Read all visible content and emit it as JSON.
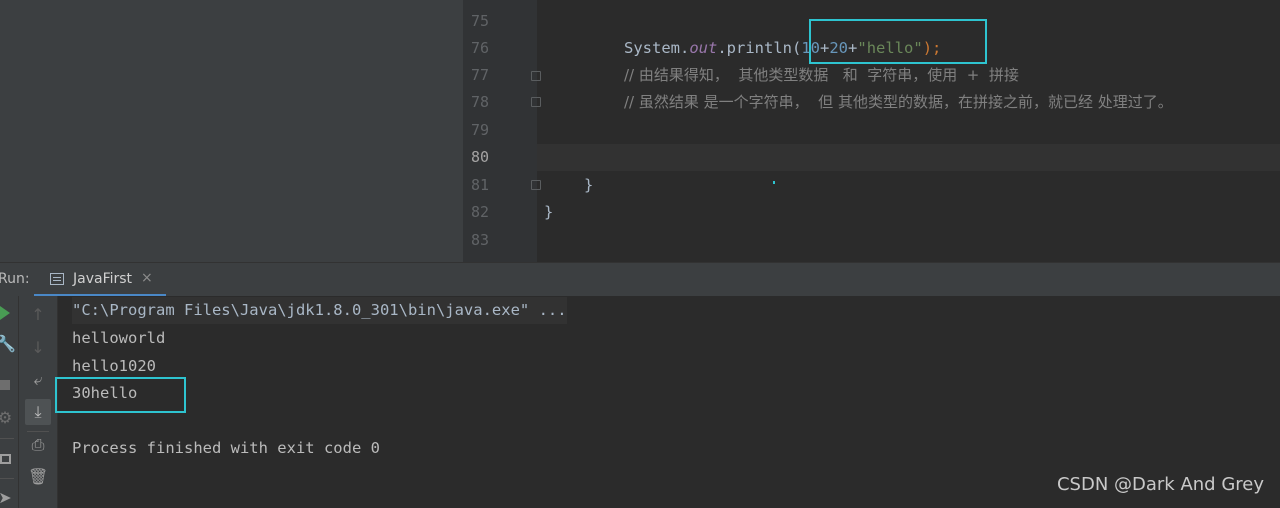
{
  "editor": {
    "lines": [
      {
        "number": "75"
      },
      {
        "number": "76",
        "code": {
          "pre": "System.",
          "field": "out",
          "mid": ".println(",
          "n1": "10",
          "plus1": "+",
          "n2": "20",
          "plus2": "+",
          "str": "\"hello\"",
          "end": ");"
        }
      },
      {
        "number": "77",
        "comment": "// 由结果得知，  其他类型数据   和  字符串，使用  +  拼接"
      },
      {
        "number": "78",
        "comment": "// 虽然结果 是一个字符串，  但 其他类型的数据，在拼接之前，就已经 处理过了。"
      },
      {
        "number": "79"
      },
      {
        "number": "80"
      },
      {
        "number": "81",
        "code_text": "}"
      },
      {
        "number": "82",
        "code_text": "}"
      },
      {
        "number": "83"
      }
    ]
  },
  "run_panel": {
    "label": "Run:",
    "tab_label": "JavaFirst",
    "tab_close": "×",
    "icons": {
      "run": "run-icon",
      "wrench": "wrench-icon",
      "stop": "stop-icon",
      "up": "arrow-up-icon",
      "down": "arrow-down-icon",
      "wrap": "soft-wrap-icon",
      "scroll_end": "scroll-to-end-icon",
      "print": "print-icon",
      "trash": "trash-icon"
    }
  },
  "console": {
    "command": "\"C:\\Program Files\\Java\\jdk1.8.0_301\\bin\\java.exe\" ...",
    "outputs": [
      "helloworld",
      "hello1020",
      "30hello"
    ],
    "exit": "Process finished with exit code 0"
  },
  "watermark": "CSDN @Dark And Grey",
  "colors": {
    "highlight": "#2ec4d0",
    "background": "#2b2b2b",
    "panel": "#3c3f41"
  }
}
